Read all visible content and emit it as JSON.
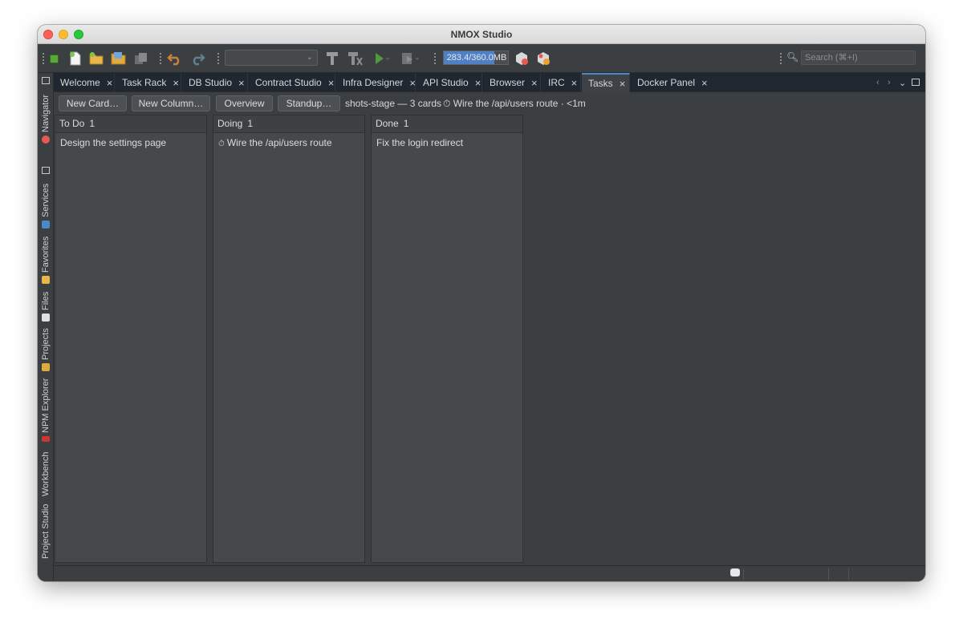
{
  "window": {
    "title": "NMOX Studio"
  },
  "toolbar": {
    "memory_text": "283.4/360.0MB",
    "memory_used_mb": 283.4,
    "memory_total_mb": 360.0,
    "memory_fraction": 0.787,
    "search_placeholder": "Search (⌘+I)"
  },
  "sidebar": {
    "items": [
      "Navigator",
      "Services",
      "Favorites",
      "Files",
      "Projects",
      "NPM Explorer",
      "Workbench",
      "Project Studio"
    ]
  },
  "tabs": [
    {
      "label": "Welcome",
      "active": false
    },
    {
      "label": "Task Rack",
      "active": false
    },
    {
      "label": "DB Studio",
      "active": false
    },
    {
      "label": "Contract Studio",
      "active": false
    },
    {
      "label": "Infra Designer",
      "active": false
    },
    {
      "label": "API Studio",
      "active": false
    },
    {
      "label": "Browser",
      "active": false
    },
    {
      "label": "IRC",
      "active": false
    },
    {
      "label": "Tasks",
      "active": true
    },
    {
      "label": "Docker Panel",
      "active": false
    }
  ],
  "tab_close_glyph": "×",
  "actions": {
    "new_card": "New Card…",
    "new_column": "New Column…",
    "overview": "Overview",
    "standup": "Standup…"
  },
  "board": {
    "summary": "shots-stage — 3 cards",
    "timer": "⏱ Wire the /api/users route · <1m",
    "columns": [
      {
        "title": "To Do",
        "count": "1",
        "cards": [
          {
            "text": "Design the settings page",
            "timer": ""
          }
        ]
      },
      {
        "title": "Doing",
        "count": "1",
        "cards": [
          {
            "text": "Wire the /api/users route",
            "timer": "⏱"
          }
        ]
      },
      {
        "title": "Done",
        "count": "1",
        "cards": [
          {
            "text": "Fix the login redirect",
            "timer": ""
          }
        ]
      }
    ]
  },
  "colors": {
    "accent": "#4a88c7",
    "memory_fill": "#4f7fc4",
    "background": "#3c3f41",
    "tabbar": "#1f2731"
  }
}
